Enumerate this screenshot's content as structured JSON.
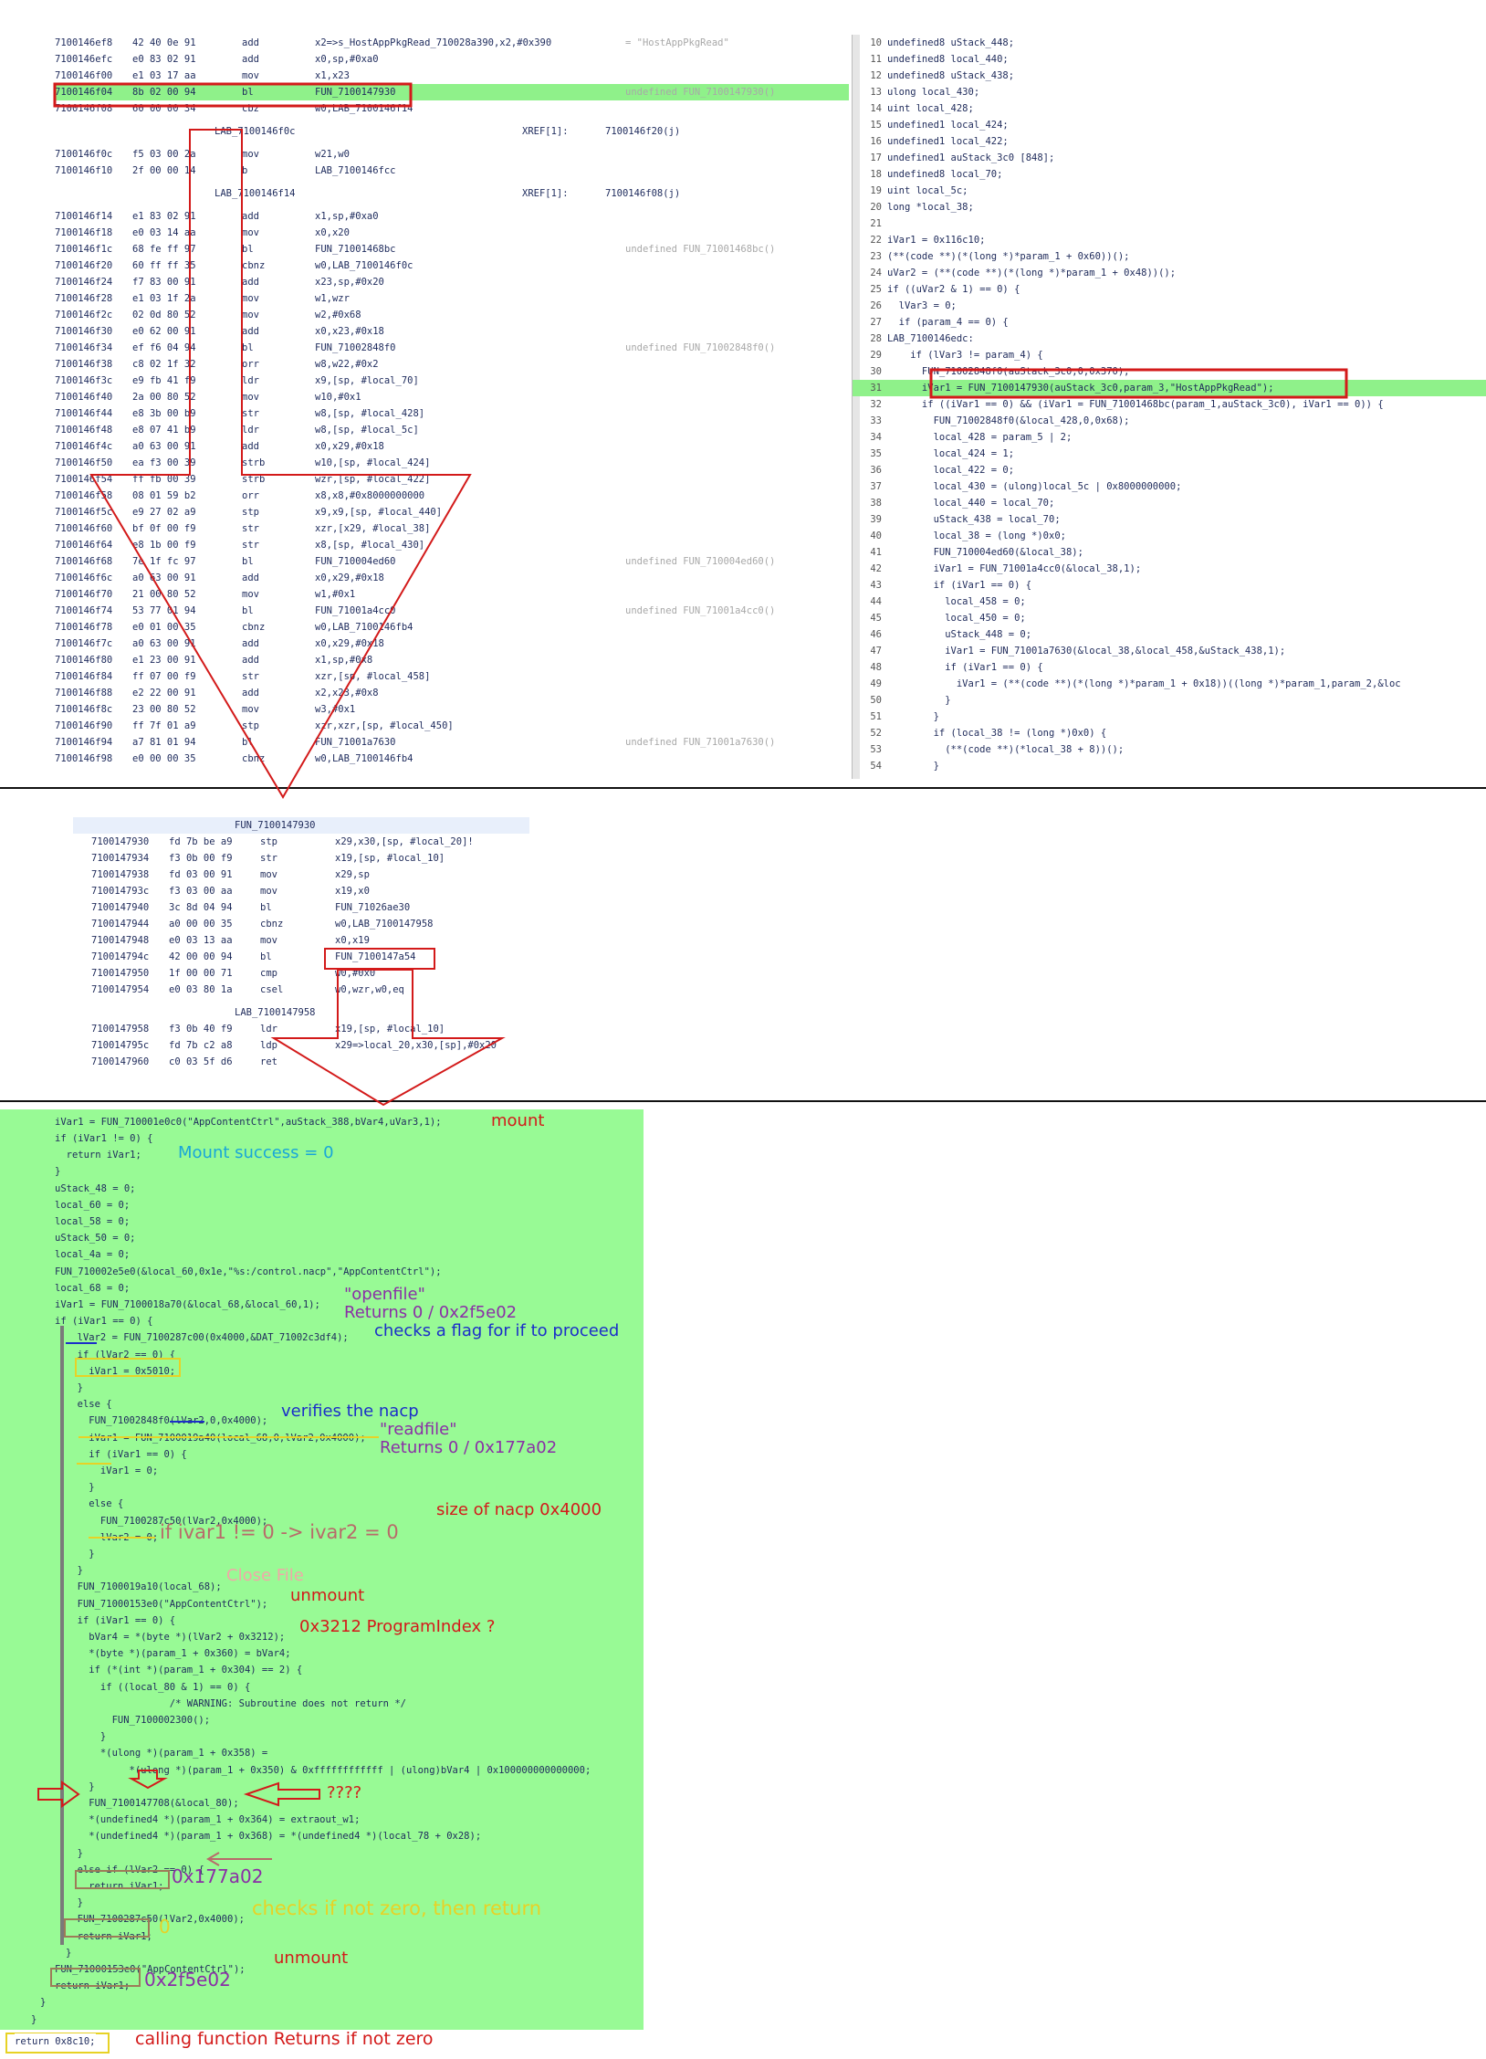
{
  "listing_top": {
    "rows": [
      {
        "addr": "7100146ef8",
        "bytes": "42 40 0e 91",
        "mn": "add",
        "ops": "x2=>s_HostAppPkgRead_710028a390,x2,#0x390",
        "cmt": "= \"HostAppPkgRead\""
      },
      {
        "addr": "7100146efc",
        "bytes": "e0 83 02 91",
        "mn": "add",
        "ops": "x0,sp,#0xa0",
        "cmt": ""
      },
      {
        "addr": "7100146f00",
        "bytes": "e1 03 17 aa",
        "mn": "mov",
        "ops": "x1,x23",
        "cmt": ""
      },
      {
        "addr": "7100146f04",
        "bytes": "8b 02 00 94",
        "mn": "bl",
        "ops": "FUN_7100147930",
        "cmt": "undefined FUN_7100147930()"
      },
      {
        "addr": "7100146f08",
        "bytes": "60 00 00 34",
        "mn": "cbz",
        "ops": "w0,LAB_7100146f14",
        "cmt": ""
      },
      {
        "label": "LAB_7100146f0c",
        "xref": "XREF[1]:",
        "xref_to": "7100146f20(j)"
      },
      {
        "addr": "7100146f0c",
        "bytes": "f5 03 00 2a",
        "mn": "mov",
        "ops": "w21,w0",
        "cmt": ""
      },
      {
        "addr": "7100146f10",
        "bytes": "2f 00 00 14",
        "mn": "b",
        "ops": "LAB_7100146fcc",
        "cmt": ""
      },
      {
        "label": "LAB_7100146f14",
        "xref": "XREF[1]:",
        "xref_to": "7100146f08(j)"
      },
      {
        "addr": "7100146f14",
        "bytes": "e1 83 02 91",
        "mn": "add",
        "ops": "x1,sp,#0xa0",
        "cmt": ""
      },
      {
        "addr": "7100146f18",
        "bytes": "e0 03 14 aa",
        "mn": "mov",
        "ops": "x0,x20",
        "cmt": ""
      },
      {
        "addr": "7100146f1c",
        "bytes": "68 fe ff 97",
        "mn": "bl",
        "ops": "FUN_71001468bc",
        "cmt": "undefined FUN_71001468bc()"
      },
      {
        "addr": "7100146f20",
        "bytes": "60 ff ff 35",
        "mn": "cbnz",
        "ops": "w0,LAB_7100146f0c",
        "cmt": ""
      },
      {
        "addr": "7100146f24",
        "bytes": "f7 83 00 91",
        "mn": "add",
        "ops": "x23,sp,#0x20",
        "cmt": ""
      },
      {
        "addr": "7100146f28",
        "bytes": "e1 03 1f 2a",
        "mn": "mov",
        "ops": "w1,wzr",
        "cmt": ""
      },
      {
        "addr": "7100146f2c",
        "bytes": "02 0d 80 52",
        "mn": "mov",
        "ops": "w2,#0x68",
        "cmt": ""
      },
      {
        "addr": "7100146f30",
        "bytes": "e0 62 00 91",
        "mn": "add",
        "ops": "x0,x23,#0x18",
        "cmt": ""
      },
      {
        "addr": "7100146f34",
        "bytes": "ef f6 04 94",
        "mn": "bl",
        "ops": "FUN_71002848f0",
        "cmt": "undefined FUN_71002848f0()"
      },
      {
        "addr": "7100146f38",
        "bytes": "c8 02 1f 32",
        "mn": "orr",
        "ops": "w8,w22,#0x2",
        "cmt": ""
      },
      {
        "addr": "7100146f3c",
        "bytes": "e9 fb 41 f9",
        "mn": "ldr",
        "ops": "x9,[sp, #local_70]",
        "cmt": ""
      },
      {
        "addr": "7100146f40",
        "bytes": "2a 00 80 52",
        "mn": "mov",
        "ops": "w10,#0x1",
        "cmt": ""
      },
      {
        "addr": "7100146f44",
        "bytes": "e8 3b 00 b9",
        "mn": "str",
        "ops": "w8,[sp, #local_428]",
        "cmt": ""
      },
      {
        "addr": "7100146f48",
        "bytes": "e8 07 41 b9",
        "mn": "ldr",
        "ops": "w8,[sp, #local_5c]",
        "cmt": ""
      },
      {
        "addr": "7100146f4c",
        "bytes": "a0 63 00 91",
        "mn": "add",
        "ops": "x0,x29,#0x18",
        "cmt": ""
      },
      {
        "addr": "7100146f50",
        "bytes": "ea f3 00 39",
        "mn": "strb",
        "ops": "w10,[sp, #local_424]",
        "cmt": ""
      },
      {
        "addr": "7100146f54",
        "bytes": "ff fb 00 39",
        "mn": "strb",
        "ops": "wzr,[sp, #local_422]",
        "cmt": ""
      },
      {
        "addr": "7100146f58",
        "bytes": "08 01 59 b2",
        "mn": "orr",
        "ops": "x8,x8,#0x8000000000",
        "cmt": ""
      },
      {
        "addr": "7100146f5c",
        "bytes": "e9 27 02 a9",
        "mn": "stp",
        "ops": "x9,x9,[sp, #local_440]",
        "cmt": ""
      },
      {
        "addr": "7100146f60",
        "bytes": "bf 0f 00 f9",
        "mn": "str",
        "ops": "xzr,[x29, #local_38]",
        "cmt": ""
      },
      {
        "addr": "7100146f64",
        "bytes": "e8 1b 00 f9",
        "mn": "str",
        "ops": "x8,[sp, #local_430]",
        "cmt": ""
      },
      {
        "addr": "7100146f68",
        "bytes": "7e 1f fc 97",
        "mn": "bl",
        "ops": "FUN_710004ed60",
        "cmt": "undefined FUN_710004ed60()"
      },
      {
        "addr": "7100146f6c",
        "bytes": "a0 63 00 91",
        "mn": "add",
        "ops": "x0,x29,#0x18",
        "cmt": ""
      },
      {
        "addr": "7100146f70",
        "bytes": "21 00 80 52",
        "mn": "mov",
        "ops": "w1,#0x1",
        "cmt": ""
      },
      {
        "addr": "7100146f74",
        "bytes": "53 77 01 94",
        "mn": "bl",
        "ops": "FUN_71001a4cc0",
        "cmt": "undefined FUN_71001a4cc0()"
      },
      {
        "addr": "7100146f78",
        "bytes": "e0 01 00 35",
        "mn": "cbnz",
        "ops": "w0,LAB_7100146fb4",
        "cmt": ""
      },
      {
        "addr": "7100146f7c",
        "bytes": "a0 63 00 91",
        "mn": "add",
        "ops": "x0,x29,#0x18",
        "cmt": ""
      },
      {
        "addr": "7100146f80",
        "bytes": "e1 23 00 91",
        "mn": "add",
        "ops": "x1,sp,#0x8",
        "cmt": ""
      },
      {
        "addr": "7100146f84",
        "bytes": "ff 07 00 f9",
        "mn": "str",
        "ops": "xzr,[sp, #local_458]",
        "cmt": ""
      },
      {
        "addr": "7100146f88",
        "bytes": "e2 22 00 91",
        "mn": "add",
        "ops": "x2,x23,#0x8",
        "cmt": ""
      },
      {
        "addr": "7100146f8c",
        "bytes": "23 00 80 52",
        "mn": "mov",
        "ops": "w3,#0x1",
        "cmt": ""
      },
      {
        "addr": "7100146f90",
        "bytes": "ff 7f 01 a9",
        "mn": "stp",
        "ops": "xzr,xzr,[sp, #local_450]",
        "cmt": ""
      },
      {
        "addr": "7100146f94",
        "bytes": "a7 81 01 94",
        "mn": "bl",
        "ops": "FUN_71001a7630",
        "cmt": "undefined FUN_71001a7630()"
      },
      {
        "addr": "7100146f98",
        "bytes": "e0 00 00 35",
        "mn": "cbnz",
        "ops": "w0,LAB_7100146fb4",
        "cmt": ""
      }
    ]
  },
  "decompile_right": {
    "lines": [
      {
        "n": "10",
        "t": "undefined8 uStack_448;"
      },
      {
        "n": "11",
        "t": "undefined8 local_440;"
      },
      {
        "n": "12",
        "t": "undefined8 uStack_438;"
      },
      {
        "n": "13",
        "t": "ulong local_430;"
      },
      {
        "n": "14",
        "t": "uint local_428;"
      },
      {
        "n": "15",
        "t": "undefined1 local_424;"
      },
      {
        "n": "16",
        "t": "undefined1 local_422;"
      },
      {
        "n": "17",
        "t": "undefined1 auStack_3c0 [848];"
      },
      {
        "n": "18",
        "t": "undefined8 local_70;"
      },
      {
        "n": "19",
        "t": "uint local_5c;"
      },
      {
        "n": "20",
        "t": "long *local_38;"
      },
      {
        "n": "21",
        "t": ""
      },
      {
        "n": "22",
        "t": "iVar1 = 0x116c10;"
      },
      {
        "n": "23",
        "t": "(**(code **)(*(long *)*param_1 + 0x60))();"
      },
      {
        "n": "24",
        "t": "uVar2 = (**(code **)(*(long *)*param_1 + 0x48))();"
      },
      {
        "n": "25",
        "t": "if ((uVar2 & 1) == 0) {"
      },
      {
        "n": "26",
        "t": "  lVar3 = 0;"
      },
      {
        "n": "27",
        "t": "  if (param_4 == 0) {"
      },
      {
        "n": "28",
        "t": "LAB_7100146edc:"
      },
      {
        "n": "29",
        "t": "    if (lVar3 != param_4) {"
      },
      {
        "n": "30",
        "t": "      FUN_71002848f0(auStack_3c0,0,0x370);"
      },
      {
        "n": "31",
        "t": "      iVar1 = FUN_7100147930(auStack_3c0,param_3,\"HostAppPkgRead\");"
      },
      {
        "n": "32",
        "t": "      if ((iVar1 == 0) && (iVar1 = FUN_71001468bc(param_1,auStack_3c0), iVar1 == 0)) {"
      },
      {
        "n": "33",
        "t": "        FUN_71002848f0(&local_428,0,0x68);"
      },
      {
        "n": "34",
        "t": "        local_428 = param_5 | 2;"
      },
      {
        "n": "35",
        "t": "        local_424 = 1;"
      },
      {
        "n": "36",
        "t": "        local_422 = 0;"
      },
      {
        "n": "37",
        "t": "        local_430 = (ulong)local_5c | 0x8000000000;"
      },
      {
        "n": "38",
        "t": "        local_440 = local_70;"
      },
      {
        "n": "39",
        "t": "        uStack_438 = local_70;"
      },
      {
        "n": "40",
        "t": "        local_38 = (long *)0x0;"
      },
      {
        "n": "41",
        "t": "        FUN_710004ed60(&local_38);"
      },
      {
        "n": "42",
        "t": "        iVar1 = FUN_71001a4cc0(&local_38,1);"
      },
      {
        "n": "43",
        "t": "        if (iVar1 == 0) {"
      },
      {
        "n": "44",
        "t": "          local_458 = 0;"
      },
      {
        "n": "45",
        "t": "          local_450 = 0;"
      },
      {
        "n": "46",
        "t": "          uStack_448 = 0;"
      },
      {
        "n": "47",
        "t": "          iVar1 = FUN_71001a7630(&local_38,&local_458,&uStack_438,1);"
      },
      {
        "n": "48",
        "t": "          if (iVar1 == 0) {"
      },
      {
        "n": "49",
        "t": "            iVar1 = (**(code **)(*(long *)*param_1 + 0x18))((long *)*param_1,param_2,&loc"
      },
      {
        "n": "50",
        "t": "          }"
      },
      {
        "n": "51",
        "t": "        }"
      },
      {
        "n": "52",
        "t": "        if (local_38 != (long *)0x0) {"
      },
      {
        "n": "53",
        "t": "          (**(code **)(*local_38 + 8))();"
      },
      {
        "n": "54",
        "t": "        }"
      }
    ]
  },
  "listing_mid": {
    "func_label": "FUN_7100147930",
    "rows": [
      {
        "addr": "7100147930",
        "bytes": "fd 7b be a9",
        "mn": "stp",
        "ops": "x29,x30,[sp, #local_20]!"
      },
      {
        "addr": "7100147934",
        "bytes": "f3 0b 00 f9",
        "mn": "str",
        "ops": "x19,[sp, #local_10]"
      },
      {
        "addr": "7100147938",
        "bytes": "fd 03 00 91",
        "mn": "mov",
        "ops": "x29,sp"
      },
      {
        "addr": "710014793c",
        "bytes": "f3 03 00 aa",
        "mn": "mov",
        "ops": "x19,x0"
      },
      {
        "addr": "7100147940",
        "bytes": "3c 8d 04 94",
        "mn": "bl",
        "ops": "FUN_71026ae30"
      },
      {
        "addr": "7100147944",
        "bytes": "a0 00 00 35",
        "mn": "cbnz",
        "ops": "w0,LAB_7100147958"
      },
      {
        "addr": "7100147948",
        "bytes": "e0 03 13 aa",
        "mn": "mov",
        "ops": "x0,x19"
      },
      {
        "addr": "710014794c",
        "bytes": "42 00 00 94",
        "mn": "bl",
        "ops": "FUN_7100147a54"
      },
      {
        "addr": "7100147950",
        "bytes": "1f 00 00 71",
        "mn": "cmp",
        "ops": "w0,#0x0"
      },
      {
        "addr": "7100147954",
        "bytes": "e0 03 80 1a",
        "mn": "csel",
        "ops": "w0,wzr,w0,eq"
      },
      {
        "label": "LAB_7100147958"
      },
      {
        "addr": "7100147958",
        "bytes": "f3 0b 40 f9",
        "mn": "ldr",
        "ops": "x19,[sp, #local_10]"
      },
      {
        "addr": "710014795c",
        "bytes": "fd 7b c2 a8",
        "mn": "ldp",
        "ops": "x29=>local_20,x30,[sp],#0x20"
      },
      {
        "addr": "7100147960",
        "bytes": "c0 03 5f d6",
        "mn": "ret",
        "ops": ""
      }
    ]
  },
  "green_code": {
    "lines": [
      "iVar1 = FUN_710001e0c0(\"AppContentCtrl\",auStack_388,bVar4,uVar3,1);",
      "if (iVar1 != 0) {",
      "  return iVar1;",
      "}",
      "uStack_48 = 0;",
      "local_60 = 0;",
      "local_58 = 0;",
      "uStack_50 = 0;",
      "local_4a = 0;",
      "FUN_710002e5e0(&local_60,0x1e,\"%s:/control.nacp\",\"AppContentCtrl\");",
      "local_68 = 0;",
      "iVar1 = FUN_7100018a70(&local_68,&local_60,1);",
      "if (iVar1 == 0) {",
      "  lVar2 = FUN_7100287c00(0x4000,&DAT_71002c3df4);",
      "  if (lVar2 == 0) {",
      "    iVar1 = 0x5010;",
      "  }",
      "  else {",
      "    FUN_71002848f0(lVar2,0,0x4000);",
      "    iVar1 = FUN_7100019a40(local_68,0,lVar2,0x4000);",
      "    if (iVar1 == 0) {",
      "      iVar1 = 0;",
      "    }",
      "    else {",
      "      FUN_7100287c50(lVar2,0x4000);",
      "      lVar2 = 0;",
      "    }",
      "  }",
      "  FUN_7100019a10(local_68);",
      "  FUN_71000153e0(\"AppContentCtrl\");",
      "  if (iVar1 == 0) {",
      "    bVar4 = *(byte *)(lVar2 + 0x3212);",
      "    *(byte *)(param_1 + 0x360) = bVar4;",
      "    if (*(int *)(param_1 + 0x304) == 2) {",
      "      if ((local_80 & 1) == 0) {",
      "                  /* WARNING: Subroutine does not return */",
      "        FUN_7100002300();",
      "      }",
      "      *(ulong *)(param_1 + 0x358) =",
      "           *(ulong *)(param_1 + 0x350) & 0xffffffffffff | (ulong)bVar4 | 0x100000000000000;",
      "    }",
      "    FUN_7100147708(&local_80);",
      "    *(undefined4 *)(param_1 + 0x364) = extraout_w1;",
      "    *(undefined4 *)(param_1 + 0x368) = *(undefined4 *)(local_78 + 0x28);",
      "  }",
      "  else if (lVar2 == 0) {",
      "    return iVar1;",
      "  }",
      "  FUN_7100287c50(lVar2,0x4000);",
      "  return iVar1;",
      "}",
      "FUN_71000153e0(\"AppContentCtrl\");",
      "return iVar1;",
      "}",
      "}"
    ],
    "final_return": "return 0x8c10;"
  },
  "annotations": {
    "mount": "mount",
    "mount_success": "Mount success = 0",
    "openfile": "\"openfile\"",
    "returns_open": "Returns 0 / 0x2f5e02",
    "checks_flag": "checks a flag for if to proceed",
    "verifies_nacp": "verifies the nacp",
    "readfile": "\"readfile\"",
    "returns_read": "Returns 0 / 0x177a02",
    "size_nacp": "size of nacp 0x4000",
    "if_ivar1": "if ivar1 != 0 -> ivar2 = 0",
    "close_file": "Close File",
    "unmount1": "unmount",
    "program_index": "0x3212 ProgramIndex ?",
    "question": "????",
    "ret_177a02": "0x177a02",
    "checks_not_zero": "checks if not zero, then return",
    "zero": "0",
    "unmount2": "unmount",
    "ret_2f5e02": "0x2f5e02",
    "calling_fn": "calling function Returns if not zero"
  },
  "colors": {
    "highlight_green": "#8ff18a",
    "panel_green": "#98fa95",
    "red": "#d31a1a",
    "blue": "#1b2ec9",
    "cyan": "#19a6d8",
    "purple": "#8a2fa6",
    "yellow": "#e7d226",
    "pink": "#f0a8a8",
    "brown": "#9d7b58"
  }
}
